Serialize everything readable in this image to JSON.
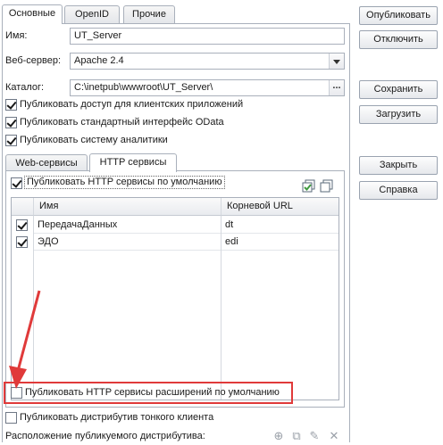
{
  "tabs": [
    {
      "label": "Основные"
    },
    {
      "label": "OpenID"
    },
    {
      "label": "Прочие"
    }
  ],
  "form": {
    "name_label": "Имя:",
    "name_value": "UT_Server",
    "webserver_label": "Веб-сервер:",
    "webserver_value": "Apache 2.4",
    "catalog_label": "Каталог:",
    "catalog_value": "C:\\inetpub\\wwwroot\\UT_Server\\",
    "catalog_button": "..."
  },
  "checkboxes": {
    "client_apps": {
      "label": "Публиковать доступ для клиентских приложений",
      "checked": true
    },
    "odata": {
      "label": "Публиковать стандартный интерфейс OData",
      "checked": true
    },
    "analytics": {
      "label": "Публиковать систему аналитики",
      "checked": true
    }
  },
  "inner_tabs": [
    {
      "label": "Web-сервисы"
    },
    {
      "label": "HTTP сервисы"
    }
  ],
  "http": {
    "default_label": "Публиковать HTTP сервисы по умолчанию",
    "default_checked": true,
    "columns": [
      "Имя",
      "Корневой URL"
    ],
    "rows": [
      {
        "name": "ПередачаДанных",
        "url": "dt",
        "checked": true
      },
      {
        "name": "ЭДО",
        "url": "edi",
        "checked": true
      }
    ],
    "extensions_label": "Публиковать HTTP сервисы расширений по умолчанию",
    "extensions_checked": false
  },
  "thin_client": {
    "label": "Публиковать дистрибутив тонкого клиента",
    "checked": false,
    "location_label": "Расположение публикуемого дистрибутива:"
  },
  "buttons": {
    "publish": "Опубликовать",
    "disable": "Отключить",
    "save": "Сохранить",
    "load": "Загрузить",
    "close": "Закрыть",
    "help": "Справка"
  },
  "colors": {
    "highlight_box": "#e03a3a",
    "arrow": "#e03a3a",
    "toolbar_icon_green": "#3f9a3f"
  },
  "icons": [
    "check-all-icon",
    "uncheck-all-icon",
    "add-icon",
    "copy-icon",
    "edit-icon",
    "delete-icon"
  ]
}
